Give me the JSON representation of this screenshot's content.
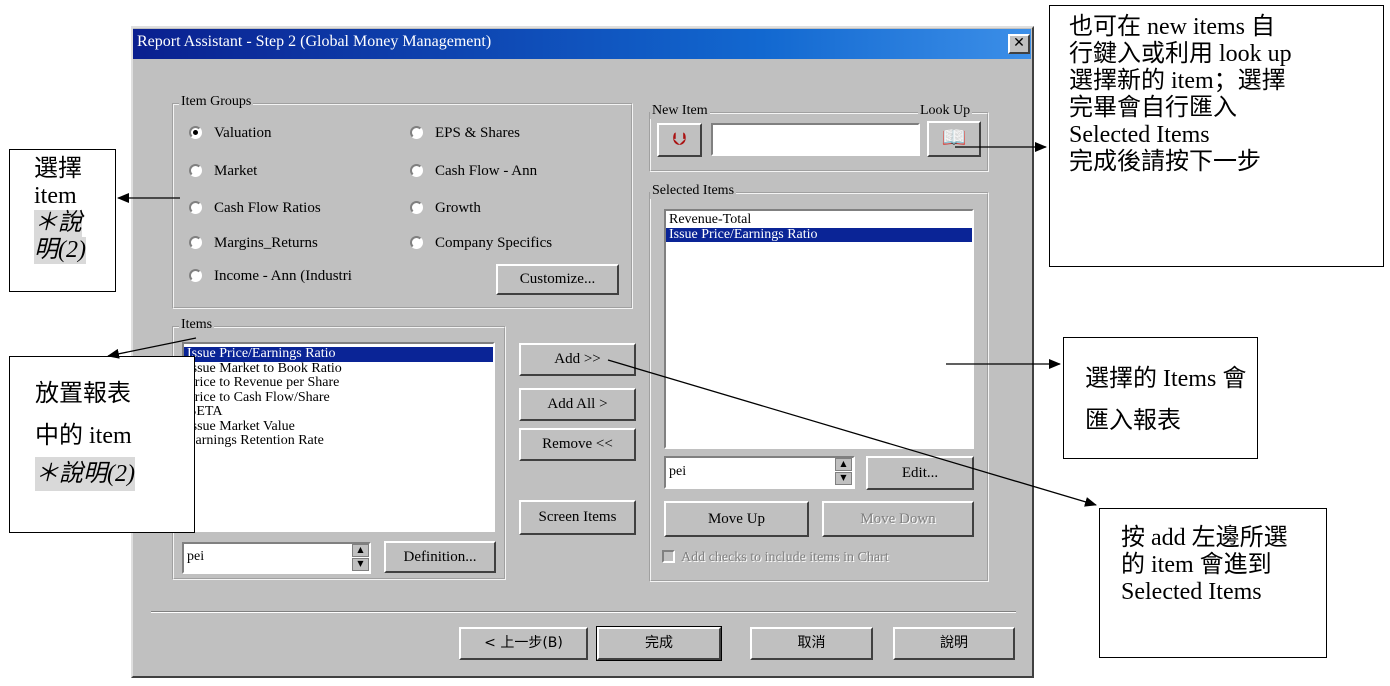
{
  "dialog": {
    "title": "Report Assistant - Step 2   (Global Money Management)",
    "close_glyph": "✕"
  },
  "item_groups": {
    "legend": "Item Groups",
    "options": [
      {
        "label": "Valuation",
        "selected": true
      },
      {
        "label": "EPS & Shares",
        "selected": false
      },
      {
        "label": "Market",
        "selected": false
      },
      {
        "label": "Cash Flow - Ann",
        "selected": false
      },
      {
        "label": "Cash Flow Ratios",
        "selected": false
      },
      {
        "label": "Growth",
        "selected": false
      },
      {
        "label": "Margins_Returns",
        "selected": false
      },
      {
        "label": "Company Specifics",
        "selected": false
      },
      {
        "label": "Income - Ann (Industri",
        "selected": false
      }
    ],
    "customize_label": "Customize..."
  },
  "items": {
    "legend": "Items",
    "list": [
      "Issue Price/Earnings Ratio",
      "Issue Market to Book Ratio",
      "Price to Revenue per Share",
      "Price to Cash Flow/Share",
      "BETA",
      "Issue Market Value",
      "Earnings Retention Rate"
    ],
    "selected_index": 0,
    "code_value": "pei",
    "definition_label": "Definition..."
  },
  "middle_buttons": {
    "add": "Add >>",
    "add_all": "Add All >",
    "remove": "Remove <<",
    "screen_items": "Screen Items"
  },
  "new_item": {
    "legend": "New Item",
    "lookup_label": "Look Up",
    "value": ""
  },
  "selected_items": {
    "legend": "Selected Items",
    "list": [
      "Revenue-Total",
      "Issue Price/Earnings Ratio"
    ],
    "selected_index": 1,
    "code_value": "pei",
    "edit_label": "Edit...",
    "move_up": "Move Up",
    "move_down": "Move Down",
    "chart_checkbox_label": "Add checks to include items in Chart"
  },
  "footer": {
    "back": "< 上一步(B)",
    "finish": "完成",
    "cancel": "取消",
    "help": "說明"
  },
  "annotations": {
    "select_item": {
      "line1": "選擇",
      "line2": "item",
      "line3": "＊說",
      "line4": "明(2)"
    },
    "place_item": {
      "line1": "放置報表",
      "line2": "中的 item",
      "line3": "＊說明(2)"
    },
    "new_items": {
      "lines": [
        "也可在 new items 自",
        "行鍵入或利用 look up",
        "選擇新的 item；選擇",
        "完畢會自行匯入",
        "Selected Items",
        "完成後請按下一步"
      ]
    },
    "selected_import": {
      "line1": "選擇的 Items 會",
      "line2": "匯入報表"
    },
    "add_button": {
      "lines": [
        "按 add  左邊所選",
        "的 item 會進到",
        "Selected Items"
      ]
    }
  }
}
